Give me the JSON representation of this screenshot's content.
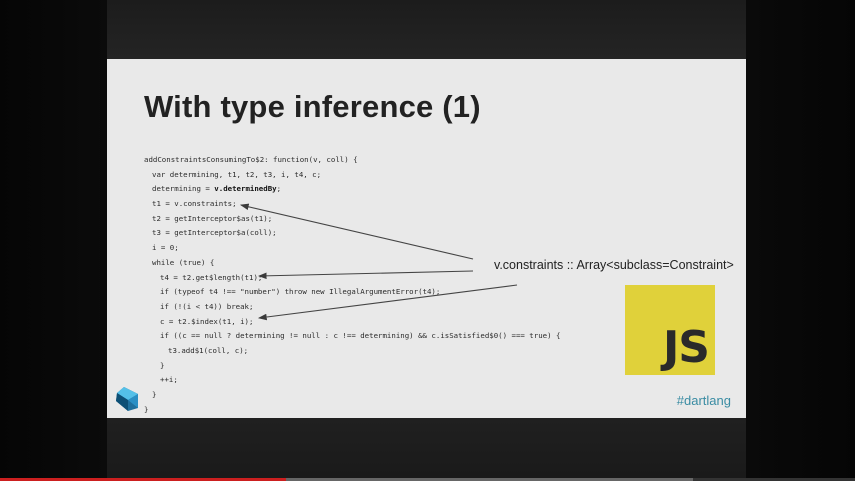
{
  "slide": {
    "title": "With type inference (1)",
    "code_lines": [
      {
        "text": "addConstraintsConsumingTo$2: function(v, coll) {",
        "indent": 0
      },
      {
        "text": "var determining, t1, t2, t3, i, t4, c;",
        "indent": 1
      },
      {
        "pre": "determining = ",
        "bold": "v.determinedBy",
        "post": ";",
        "indent": 1
      },
      {
        "text": "t1 = v.constraints;",
        "indent": 1
      },
      {
        "text": "t2 = getInterceptor$as(t1);",
        "indent": 1
      },
      {
        "text": "t3 = getInterceptor$a(coll);",
        "indent": 1
      },
      {
        "text": "i = 0;",
        "indent": 1
      },
      {
        "text": "while (true) {",
        "indent": 1
      },
      {
        "text": "t4 = t2.get$length(t1);",
        "indent": 2
      },
      {
        "text": "if (typeof t4 !== \"number\") throw new IllegalArgumentError(t4);",
        "indent": 2
      },
      {
        "text": "if (!(i < t4)) break;",
        "indent": 2
      },
      {
        "text": "c = t2.$index(t1, i);",
        "indent": 2
      },
      {
        "text": "if ((c == null ? determining != null : c !== determining) && c.isSatisfied$0() === true) {",
        "indent": 2
      },
      {
        "text": "t3.add$1(coll, c);",
        "indent": 3
      },
      {
        "text": "}",
        "indent": 2
      },
      {
        "text": "++i;",
        "indent": 2
      },
      {
        "text": "}",
        "indent": 1
      },
      {
        "text": "}",
        "indent": 0
      }
    ],
    "annotation": "v.constraints :: Array<subclass=Constraint>",
    "js_logo_text": "JS",
    "hashtag": "#dartlang"
  },
  "icons": {
    "dart": "dart-logo-icon",
    "js": "js-logo-icon"
  },
  "colors": {
    "js_yellow": "#e0d13a",
    "hashtag": "#3a8ca3",
    "progress": "#cc1f1f"
  },
  "player": {
    "progress_fraction": 0.335,
    "buffered_fraction": 0.81
  }
}
